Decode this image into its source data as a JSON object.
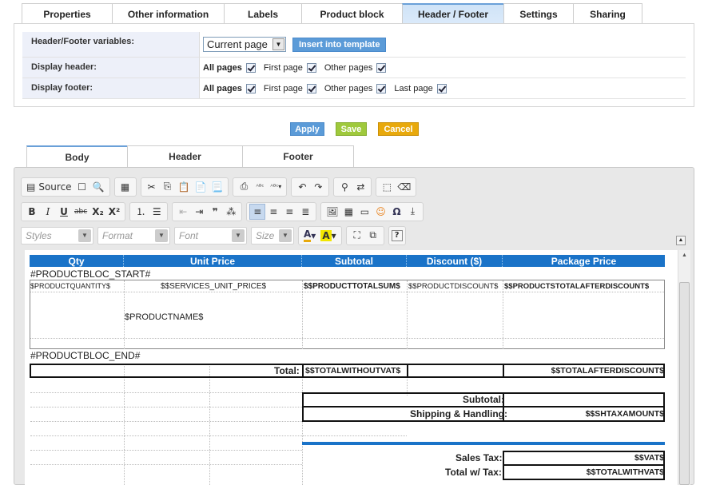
{
  "tabs": [
    "Properties",
    "Other information",
    "Labels",
    "Product block",
    "Header / Footer",
    "Settings",
    "Sharing"
  ],
  "active_tab": "Header / Footer",
  "settings": {
    "vars_label": "Header/Footer variables:",
    "vars_select": "Current page",
    "insert_button": "Insert into template",
    "header_label": "Display header:",
    "footer_label": "Display footer:",
    "all_pages": "All pages",
    "first_page": "First page",
    "other_pages": "Other pages",
    "last_page": "Last page"
  },
  "actions": {
    "apply": "Apply",
    "save": "Save",
    "cancel": "Cancel"
  },
  "colors": {
    "apply": "#5b9bd8",
    "save": "#9fc93c",
    "cancel": "#e8a90c",
    "table_header": "#1a73c8"
  },
  "editor_tabs": [
    "Body",
    "Header",
    "Footer"
  ],
  "toolbar": {
    "source": "Source",
    "styles": "Styles",
    "format": "Format",
    "font": "Font",
    "size": "Size"
  },
  "table": {
    "headers": [
      "Qty",
      "Unit Price",
      "Subtotal",
      "Discount ($)",
      "Package Price"
    ],
    "bloc_start": "#PRODUCTBLOC_START#",
    "bloc_end": "#PRODUCTBLOC_END#",
    "qty_var": "$PRODUCTQUANTITY$",
    "unit_price_var": "$$SERVICES_UNIT_PRICE$",
    "subtotal_var": "$$PRODUCTTOTALSUM$",
    "discount_var": "$$PRODUCTDISCOUNT$",
    "package_var": "$$PRODUCTSTOTALAFTERDISCOUNT$",
    "name_var": "$PRODUCTNAME$",
    "total_label": "Total:",
    "total_without_vat": "$$TOTALWITHOUTVAT$",
    "total_after_discount": "$$TOTALAFTERDISCOUNT$",
    "subtotal_label": "Subtotal:",
    "shipping_label": "Shipping & Handling:",
    "shipping_var": "$$SHTAXAMOUNT$",
    "sales_tax_label": "Sales Tax:",
    "vat_var": "$$VAT$",
    "total_with_tax_label": "Total w/ Tax:",
    "total_with_vat": "$$TOTALWITHVAT$"
  }
}
